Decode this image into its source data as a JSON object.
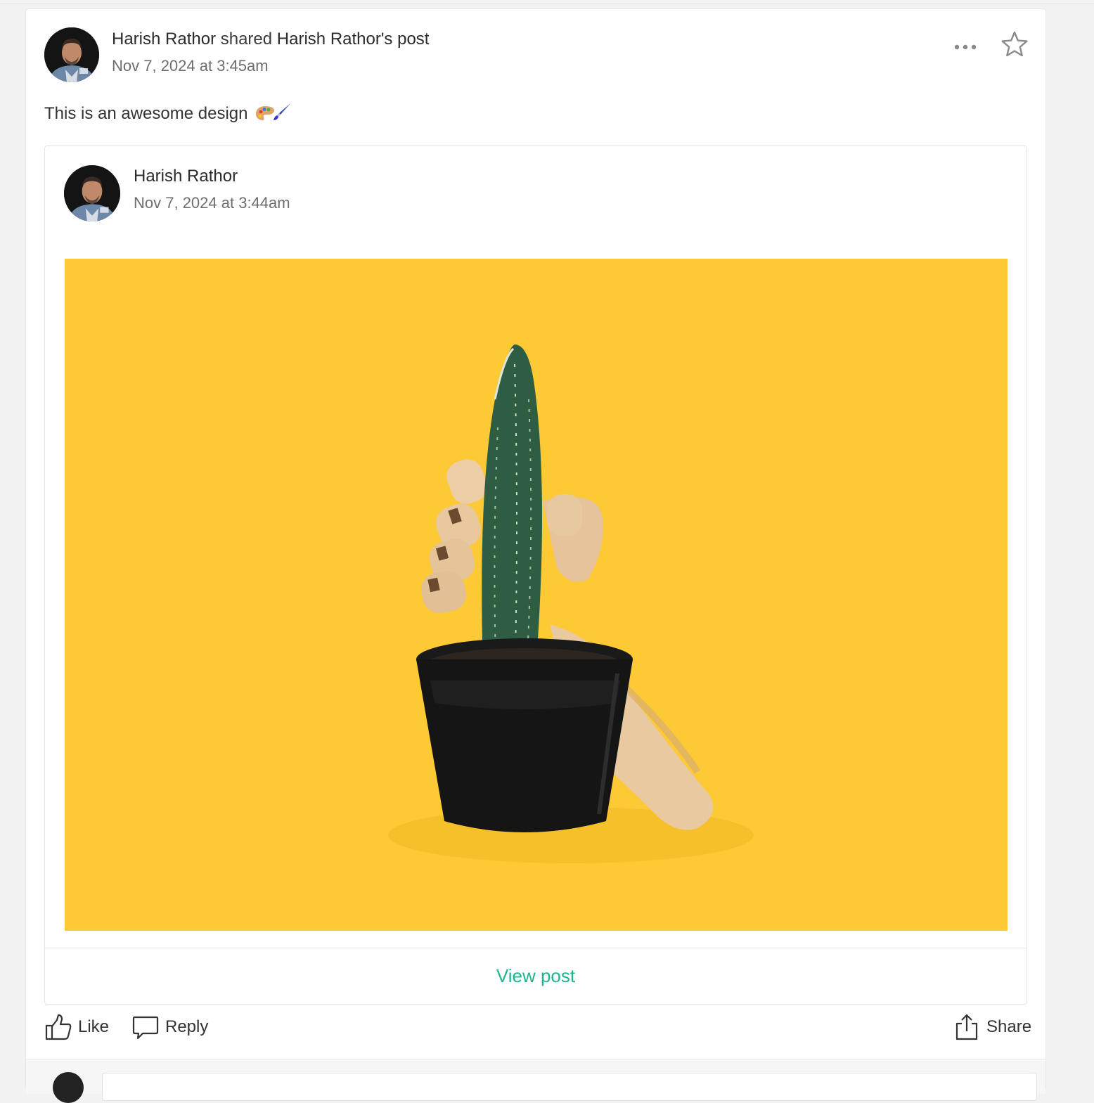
{
  "post": {
    "author": "Harish Rathor",
    "shared_word": "shared",
    "shared_owner": "Harish Rathor's post",
    "timestamp": "Nov 7, 2024 at 3:45am",
    "text": "This is an awesome design",
    "emoji_icons": [
      "artist-palette-icon",
      "paintbrush-icon"
    ],
    "more_icon": "more-horizontal-icon",
    "star_icon": "star-outline-icon"
  },
  "shared_post": {
    "author": "Harish Rathor",
    "timestamp": "Nov 7, 2024 at 3:44am",
    "image_subject": "cactus-in-pot-held-by-wooden-hand",
    "image_background": "#fdc934",
    "view_label": "View post"
  },
  "actions": {
    "like_label": "Like",
    "reply_label": "Reply",
    "share_label": "Share"
  },
  "colors": {
    "accent": "#1fb58f",
    "text": "#333333",
    "muted": "#6e6e6e"
  }
}
